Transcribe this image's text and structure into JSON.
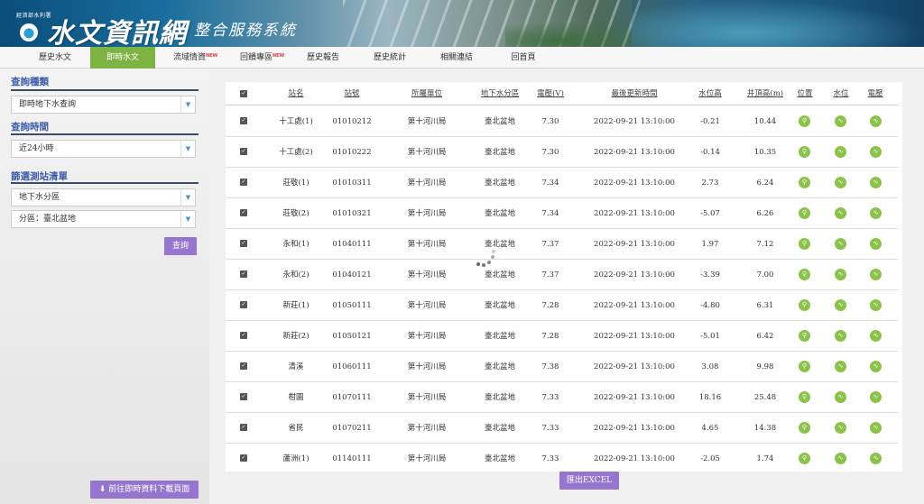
{
  "header": {
    "org": "經濟部水利署",
    "title": "水文資訊網",
    "subtitle": "整合服務系統"
  },
  "nav": {
    "items": [
      {
        "label": "歷史水文",
        "active": false,
        "new": false
      },
      {
        "label": "即時水文",
        "active": true,
        "new": false
      },
      {
        "label": "流域情資",
        "active": false,
        "new": true
      },
      {
        "label": "回饋專區",
        "active": false,
        "new": true
      },
      {
        "label": "歷史報告",
        "active": false,
        "new": false
      },
      {
        "label": "歷史統計",
        "active": false,
        "new": false
      },
      {
        "label": "相關連結",
        "active": false,
        "new": false
      },
      {
        "label": "回首頁",
        "active": false,
        "new": false
      }
    ],
    "new_badge": "NEW"
  },
  "sidebar": {
    "query_type_title": "查詢種類",
    "query_type_value": "即時地下水查詢",
    "query_time_title": "查詢時間",
    "query_time_value": "近24小時",
    "filter_title": "篩選測站清單",
    "filter_value_1": "地下水分區",
    "filter_value_2": "分區：臺北盆地",
    "query_button": "查詢",
    "download_button": "前往即時資料下載頁面"
  },
  "table": {
    "headers": [
      "站名",
      "站號",
      "所屬單位",
      "地下水分區",
      "電壓(V)",
      "最後更新時間",
      "水位高",
      "井頂高(m)",
      "位置",
      "水位",
      "電壓"
    ],
    "rows": [
      {
        "name": "十工處(1)",
        "id": "01010212",
        "unit": "第十河川局",
        "zone": "臺北盆地",
        "voltage": "7.30",
        "time": "2022-09-21 13:10:00",
        "level": "-0.21",
        "top": "10.44"
      },
      {
        "name": "十工處(2)",
        "id": "01010222",
        "unit": "第十河川局",
        "zone": "臺北盆地",
        "voltage": "7.30",
        "time": "2022-09-21 13:10:00",
        "level": "-0.14",
        "top": "10.35"
      },
      {
        "name": "莊敬(1)",
        "id": "01010311",
        "unit": "第十河川局",
        "zone": "臺北盆地",
        "voltage": "7.34",
        "time": "2022-09-21 13:10:00",
        "level": "2.73",
        "top": "6.24"
      },
      {
        "name": "莊敬(2)",
        "id": "01010321",
        "unit": "第十河川局",
        "zone": "臺北盆地",
        "voltage": "7.34",
        "time": "2022-09-21 13:10:00",
        "level": "-5.07",
        "top": "6.26"
      },
      {
        "name": "永和(1)",
        "id": "01040111",
        "unit": "第十河川局",
        "zone": "臺北盆地",
        "voltage": "7.37",
        "time": "2022-09-21 13:10:00",
        "level": "1.97",
        "top": "7.12"
      },
      {
        "name": "永和(2)",
        "id": "01040121",
        "unit": "第十河川局",
        "zone": "臺北盆地",
        "voltage": "7.37",
        "time": "2022-09-21 13:10:00",
        "level": "-3.39",
        "top": "7.00"
      },
      {
        "name": "新莊(1)",
        "id": "01050111",
        "unit": "第十河川局",
        "zone": "臺北盆地",
        "voltage": "7.28",
        "time": "2022-09-21 13:10:00",
        "level": "-4.80",
        "top": "6.31"
      },
      {
        "name": "新莊(2)",
        "id": "01050121",
        "unit": "第十河川局",
        "zone": "臺北盆地",
        "voltage": "7.28",
        "time": "2022-09-21 13:10:00",
        "level": "-5.01",
        "top": "6.42"
      },
      {
        "name": "清溪",
        "id": "01060111",
        "unit": "第十河川局",
        "zone": "臺北盆地",
        "voltage": "7.38",
        "time": "2022-09-21 13:10:00",
        "level": "3.08",
        "top": "9.98"
      },
      {
        "name": "柑園",
        "id": "01070111",
        "unit": "第十河川局",
        "zone": "臺北盆地",
        "voltage": "7.33",
        "time": "2022-09-21 13:10:00",
        "level": "18.16",
        "top": "25.48"
      },
      {
        "name": "省民",
        "id": "01070211",
        "unit": "第十河川局",
        "zone": "臺北盆地",
        "voltage": "7.33",
        "time": "2022-09-21 13:10:00",
        "level": "4.65",
        "top": "14.38"
      },
      {
        "name": "蘆洲(1)",
        "id": "01140111",
        "unit": "第十河川局",
        "zone": "臺北盆地",
        "voltage": "7.33",
        "time": "2022-09-21 13:10:00",
        "level": "-2.05",
        "top": "1.74"
      }
    ],
    "export_button": "匯出EXCEL"
  },
  "icons": {
    "dropdown": "chevron-down-icon",
    "checkbox": "checkbox-checked-icon",
    "location": "map-pin-icon",
    "water_level": "chart-icon",
    "voltage": "chart-icon",
    "download": "download-icon",
    "loading": "loading-spinner-icon"
  },
  "colors": {
    "nav_active": "#7cb342",
    "section_title": "#3b5ba9",
    "button": "#9575cd",
    "icon_green": "#8bc34a"
  }
}
